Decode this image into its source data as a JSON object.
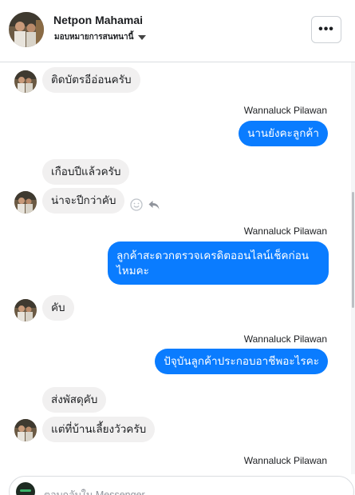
{
  "header": {
    "name": "Netpon Mahamai",
    "subtitle": "มอบหมายการสนทนานี้",
    "more_label": "•••"
  },
  "thread": [
    {
      "side": "in",
      "text": "ติดบัตรอีอ่อนครับ"
    },
    {
      "side": "out",
      "sender": "Wannaluck Pilawan",
      "text": "นานยังคะลูกค้า"
    },
    {
      "side": "in",
      "text": "เกือบปีแล้วครับ"
    },
    {
      "side": "in",
      "text": "น่าจะปีกว่าคับ"
    },
    {
      "side": "out",
      "sender": "Wannaluck Pilawan",
      "text_line1": "ลูกค้าสะดวกตรวจเครดิตออนไลน์เช็คก่อน",
      "text_line2": "ไหมคะ"
    },
    {
      "side": "in",
      "text": "คับ"
    },
    {
      "side": "out",
      "sender": "Wannaluck Pilawan",
      "text": "ปัจุบันลูกค้าประกอบอาชีพอะไรคะ"
    },
    {
      "side": "in",
      "text": "ส่งพัสดุคับ"
    },
    {
      "side": "in",
      "text": "แต่ที่บ้านเลี้ยงวัวครับ"
    },
    {
      "side": "out",
      "sender": "Wannaluck Pilawan"
    }
  ],
  "composer": {
    "placeholder": "ตอบกลับใน Messenger"
  }
}
